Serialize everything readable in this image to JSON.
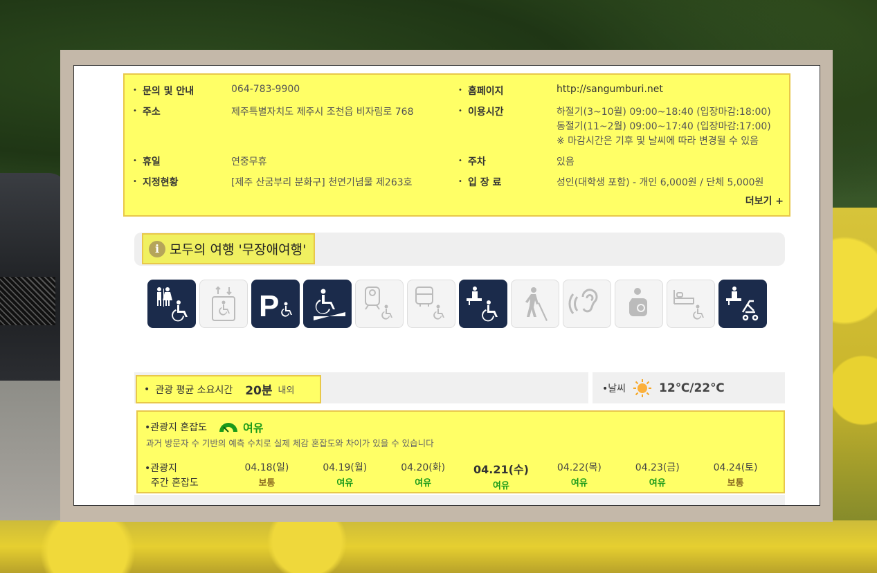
{
  "info": {
    "left": [
      {
        "label": "문의 및 안내",
        "value": "064-783-9900"
      },
      {
        "label": "주소",
        "value": "제주특별자치도 제주시 조천읍 비자림로 768"
      },
      {
        "label": "휴일",
        "value": "연중무휴"
      },
      {
        "label": "지정현황",
        "value": "[제주 산굼부리 분화구] 천연기념물 제263호"
      }
    ],
    "right": [
      {
        "label": "홈페이지",
        "value": "http://sangumburi.net"
      },
      {
        "label": "이용시간",
        "lines": [
          "하절기(3~10월) 09:00~18:40 (입장마감:18:00)",
          "동절기(11~2월) 09:00~17:40 (입장마감:17:00)",
          "※ 마감시간은 기후 및 날씨에 따라 변경될 수 있음"
        ]
      },
      {
        "label": "주차",
        "value": "있음"
      },
      {
        "label": "입 장 료",
        "value": "성인(대학생 포함) - 개인 6,000원 / 단체 5,000원"
      }
    ],
    "more_label": "더보기 +"
  },
  "accessibility": {
    "title": "모두의 여행 '무장애여행'",
    "icons": [
      {
        "name": "accessible-restroom-icon",
        "active": true
      },
      {
        "name": "elevator-icon",
        "active": false
      },
      {
        "name": "accessible-parking-icon",
        "active": true
      },
      {
        "name": "ramp-icon",
        "active": true
      },
      {
        "name": "subway-icon",
        "active": false
      },
      {
        "name": "bus-icon",
        "active": false
      },
      {
        "name": "accessible-info-desk-icon",
        "active": true
      },
      {
        "name": "visually-impaired-icon",
        "active": false
      },
      {
        "name": "hearing-impaired-icon",
        "active": false
      },
      {
        "name": "nursing-room-icon",
        "active": false
      },
      {
        "name": "accessible-lodging-icon",
        "active": false
      },
      {
        "name": "stroller-rental-icon",
        "active": true
      }
    ]
  },
  "stats": {
    "time_label": "관광 평균 소요시간",
    "time_value": "20분",
    "time_unit": "내외",
    "weather_label": "날씨",
    "weather_temp": "12℃/22℃"
  },
  "crowd": {
    "label": "관광지 혼잡도",
    "level": "여유",
    "note": "과거 방문자 수 기반의 예측 수치로 실제 체감 혼잡도와 차이가 있을 수 있습니다",
    "weekly_label_1": "관광지",
    "weekly_label_2": "주간 혼잡도",
    "days": [
      {
        "date": "04.18(일)",
        "status": "보통",
        "today": false
      },
      {
        "date": "04.19(월)",
        "status": "여유",
        "today": false
      },
      {
        "date": "04.20(화)",
        "status": "여유",
        "today": false
      },
      {
        "date": "04.21(수)",
        "status": "여유",
        "today": true
      },
      {
        "date": "04.22(목)",
        "status": "여유",
        "today": false
      },
      {
        "date": "04.23(금)",
        "status": "여유",
        "today": false
      },
      {
        "date": "04.24(토)",
        "status": "보통",
        "today": false
      }
    ]
  },
  "colors": {
    "highlight": "#ffff66",
    "icon_active": "#1b2b4b",
    "good": "#1a9a1a",
    "normal": "#8a6a20"
  }
}
